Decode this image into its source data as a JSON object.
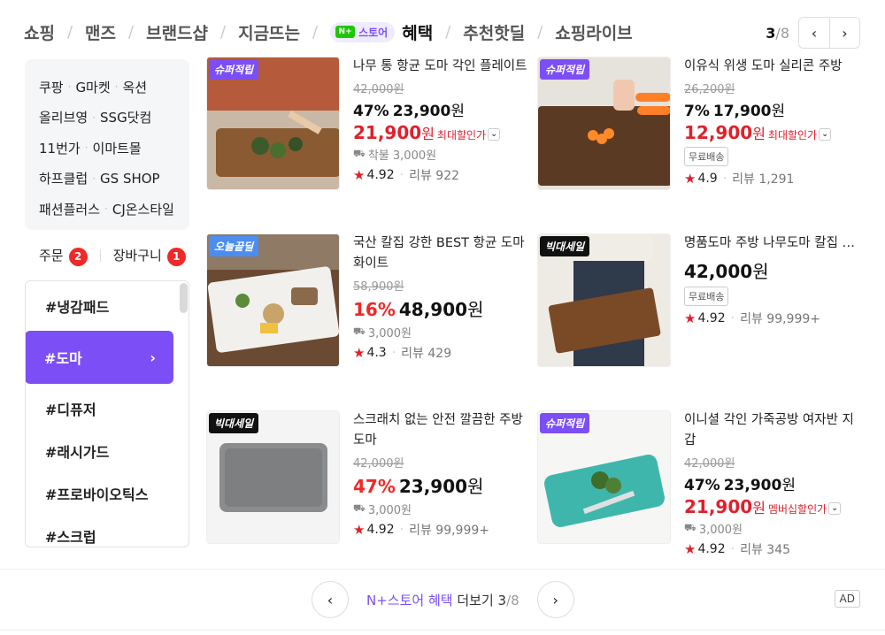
{
  "nav": {
    "tabs": [
      "쇼핑",
      "맨즈",
      "브랜드샵",
      "지금뜨는"
    ],
    "store_badge": "스토어",
    "store_logo": "N+",
    "active_tab": "혜택",
    "tabs_after": [
      "추천핫딜",
      "쇼핑라이브"
    ],
    "page_current": "3",
    "page_total": "/8",
    "prev_icon": "chevron-left-icon",
    "next_icon": "chevron-right-icon"
  },
  "malls": [
    [
      "쿠팡",
      "G마켓",
      "옥션"
    ],
    [
      "올리브영",
      "SSG닷컴"
    ],
    [
      "11번가",
      "이마트몰"
    ],
    [
      "하프클럽",
      "GS SHOP"
    ],
    [
      "패션플러스",
      "CJ온스타일"
    ]
  ],
  "orders": {
    "order_label": "주문",
    "order_count": "2",
    "cart_label": "장바구니",
    "cart_count": "1"
  },
  "keywords": {
    "items": [
      "#냉감패드",
      "#도마",
      "#디퓨저",
      "#래시가드",
      "#프로바이오틱스",
      "#스크럽"
    ],
    "active": "#도마"
  },
  "products": [
    {
      "tag": "슈퍼적립",
      "tag_color": "purple",
      "title": "나무 통 항균 도마 각인 플레이트",
      "orig": "42,000원",
      "pct": "47%",
      "price": "23,900",
      "won": "원",
      "max_price": "21,900",
      "max_label": "최대할인가",
      "ship": "착불 3,000원",
      "rating": "4.92",
      "reviews": "리뷰 922"
    },
    {
      "tag": "슈퍼적립",
      "tag_color": "purple",
      "title": "이유식 위생 도마 실리콘 주방",
      "orig": "26,200원",
      "pct": "7%",
      "price": "17,900",
      "won": "원",
      "max_price": "12,900",
      "max_label": "최대할인가",
      "freeship": "무료배송",
      "rating": "4.9",
      "reviews": "리뷰 1,291"
    },
    {
      "tag": "오늘끝딜",
      "tag_color": "blue",
      "title": "국산 칼집 강한 BEST 항균 도마 화이트",
      "orig": "58,900원",
      "pct": "16%",
      "price": "48,900",
      "won": "원",
      "ship": "3,000원",
      "rating": "4.3",
      "reviews": "리뷰 429"
    },
    {
      "tag": "빅대세일",
      "tag_color": "black",
      "title": "명품도마 주방 나무도마 칼집 원목",
      "price": "42,000",
      "won": "원",
      "freeship": "무료배송",
      "rating": "4.92",
      "reviews": "리뷰 99,999+"
    },
    {
      "tag": "빅대세일",
      "tag_color": "black",
      "title": "스크래치 없는 안전 깔끔한 주방 도마",
      "orig": "42,000원",
      "pct": "47%",
      "price": "23,900",
      "won": "원",
      "ship": "3,000원",
      "rating": "4.92",
      "reviews": "리뷰 99,999+"
    },
    {
      "tag": "슈퍼적립",
      "tag_color": "purple",
      "title": "이니셜 각인 가죽공방 여자반 지갑",
      "orig": "42,000원",
      "pct": "47%",
      "price": "23,900",
      "won": "원",
      "max_price": "21,900",
      "max_label": "멤버십할인가",
      "ship": "3,000원",
      "rating": "4.92",
      "reviews": "리뷰 345"
    }
  ],
  "footer": {
    "store_text": "N+스토어 혜택",
    "more_text": "더보기",
    "page_current": "3",
    "page_total": "/8",
    "ad_label": "AD"
  }
}
